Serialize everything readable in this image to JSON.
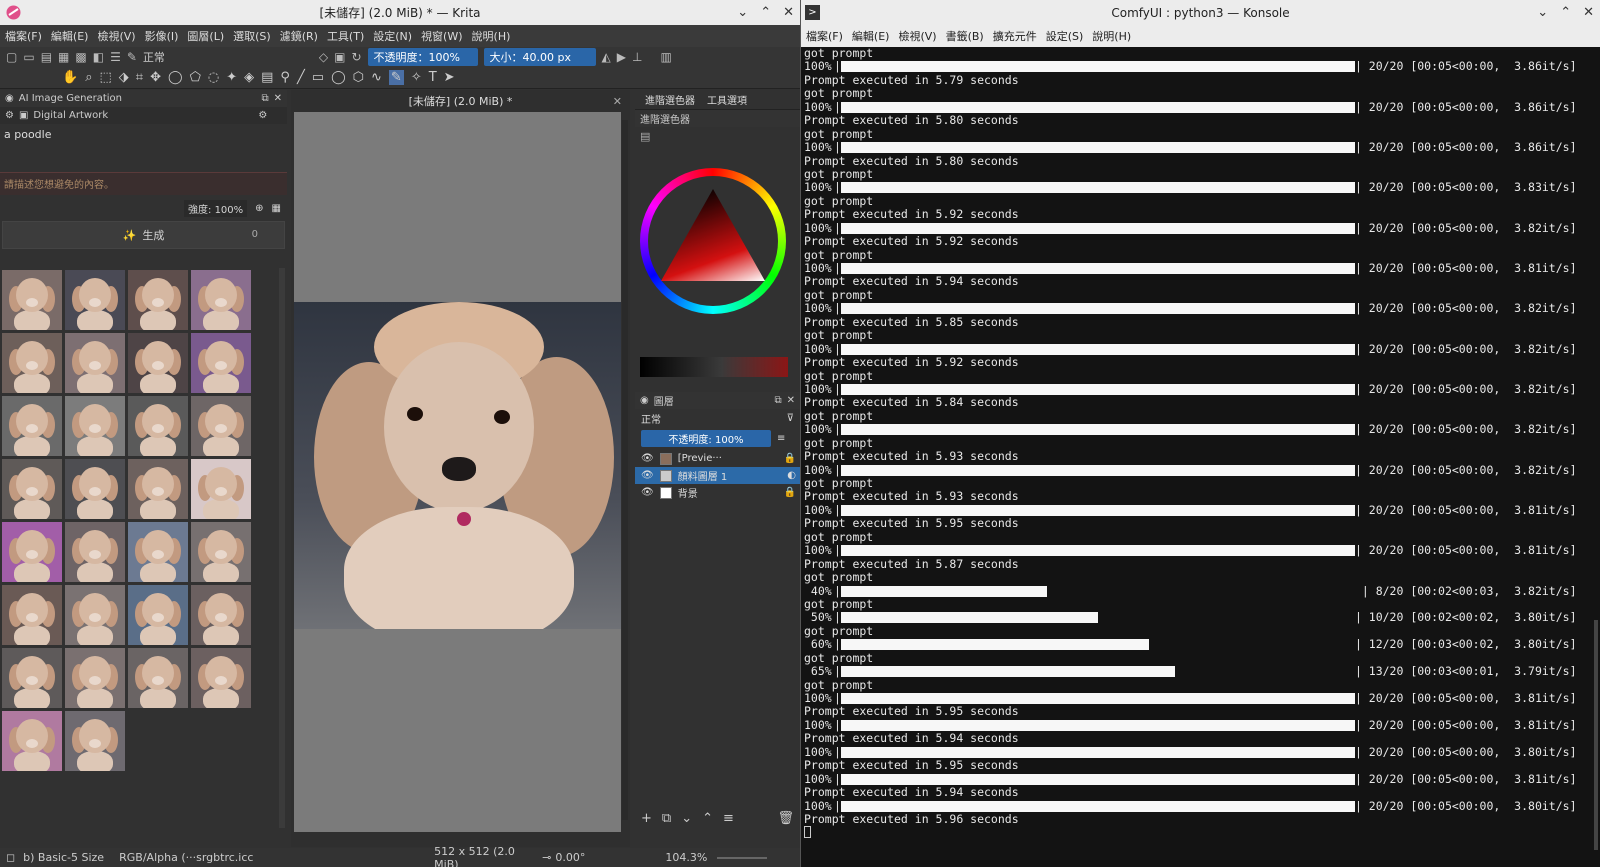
{
  "krita": {
    "title": "[未儲存] (2.0 MiB) * — Krita",
    "menu": [
      "檔案(F)",
      "編輯(E)",
      "檢視(V)",
      "影像(I)",
      "圖層(L)",
      "選取(S)",
      "濾鏡(R)",
      "工具(T)",
      "設定(N)",
      "視窗(W)",
      "說明(H)"
    ],
    "toolbar": {
      "blend_mode": "正常",
      "opacity_label": "不透明度：100%",
      "size_label": "大小",
      "size_value": "40.00 px"
    },
    "ai_panel": {
      "title": "AI Image Generation",
      "style": "Digital Artwork",
      "prompt": "a poodle",
      "negative_placeholder": "請描述您想避免的內容。",
      "strength": "強度: 100%",
      "generate": "生成",
      "queue_count": "0",
      "thumbnail_count": 30
    },
    "canvas": {
      "tab_title": "[未儲存] (2.0 MiB) *"
    },
    "right_panel": {
      "tab1": "進階選色器",
      "tab2": "工具選項",
      "color_header": "進階選色器",
      "layers_header": "圖層",
      "layer_blend": "正常",
      "layer_opacity": "不透明度: 100%",
      "layers": [
        {
          "name": "[Previe···",
          "selected": false
        },
        {
          "name": "顏料圖層 1",
          "selected": true
        },
        {
          "name": "背景",
          "selected": false
        }
      ]
    },
    "status": {
      "brush": "b) Basic-5 Size",
      "color_space": "RGB/Alpha (···srgbtrc.icc",
      "image_size": "512 x 512 (2.0 MiB)",
      "rotation": "0.00°",
      "zoom": "104.3%"
    }
  },
  "konsole": {
    "title": "ComfyUI : python3 — Konsole",
    "menu": [
      "檔案(F)",
      "編輯(E)",
      "檢視(V)",
      "書籤(B)",
      "擴充元件",
      "設定(S)",
      "說明(H)"
    ],
    "lines": [
      {
        "t": "text",
        "s": "got prompt"
      },
      {
        "t": "bar",
        "pct": "100%",
        "fill": 1.0,
        "stats": "| 20/20 [00:05<00:00,  3.86it/s]"
      },
      {
        "t": "text",
        "s": "Prompt executed in 5.79 seconds"
      },
      {
        "t": "text",
        "s": "got prompt"
      },
      {
        "t": "bar",
        "pct": "100%",
        "fill": 1.0,
        "stats": "| 20/20 [00:05<00:00,  3.86it/s]"
      },
      {
        "t": "text",
        "s": "Prompt executed in 5.80 seconds"
      },
      {
        "t": "text",
        "s": "got prompt"
      },
      {
        "t": "bar",
        "pct": "100%",
        "fill": 1.0,
        "stats": "| 20/20 [00:05<00:00,  3.86it/s]"
      },
      {
        "t": "text",
        "s": "Prompt executed in 5.80 seconds"
      },
      {
        "t": "text",
        "s": "got prompt"
      },
      {
        "t": "bar",
        "pct": "100%",
        "fill": 1.0,
        "stats": "| 20/20 [00:05<00:00,  3.83it/s]"
      },
      {
        "t": "text",
        "s": "got prompt"
      },
      {
        "t": "text",
        "s": "Prompt executed in 5.92 seconds"
      },
      {
        "t": "bar",
        "pct": "100%",
        "fill": 1.0,
        "stats": "| 20/20 [00:05<00:00,  3.82it/s]"
      },
      {
        "t": "text",
        "s": "Prompt executed in 5.92 seconds"
      },
      {
        "t": "text",
        "s": "got prompt"
      },
      {
        "t": "bar",
        "pct": "100%",
        "fill": 1.0,
        "stats": "| 20/20 [00:05<00:00,  3.81it/s]"
      },
      {
        "t": "text",
        "s": "Prompt executed in 5.94 seconds"
      },
      {
        "t": "text",
        "s": "got prompt"
      },
      {
        "t": "bar",
        "pct": "100%",
        "fill": 1.0,
        "stats": "| 20/20 [00:05<00:00,  3.82it/s]"
      },
      {
        "t": "text",
        "s": "Prompt executed in 5.85 seconds"
      },
      {
        "t": "text",
        "s": "got prompt"
      },
      {
        "t": "bar",
        "pct": "100%",
        "fill": 1.0,
        "stats": "| 20/20 [00:05<00:00,  3.82it/s]"
      },
      {
        "t": "text",
        "s": "Prompt executed in 5.92 seconds"
      },
      {
        "t": "text",
        "s": "got prompt"
      },
      {
        "t": "bar",
        "pct": "100%",
        "fill": 1.0,
        "stats": "| 20/20 [00:05<00:00,  3.82it/s]"
      },
      {
        "t": "text",
        "s": "Prompt executed in 5.84 seconds"
      },
      {
        "t": "text",
        "s": "got prompt"
      },
      {
        "t": "bar",
        "pct": "100%",
        "fill": 1.0,
        "stats": "| 20/20 [00:05<00:00,  3.82it/s]"
      },
      {
        "t": "text",
        "s": "got prompt"
      },
      {
        "t": "text",
        "s": "Prompt executed in 5.93 seconds"
      },
      {
        "t": "bar",
        "pct": "100%",
        "fill": 1.0,
        "stats": "| 20/20 [00:05<00:00,  3.82it/s]"
      },
      {
        "t": "text",
        "s": "got prompt"
      },
      {
        "t": "text",
        "s": "Prompt executed in 5.93 seconds"
      },
      {
        "t": "bar",
        "pct": "100%",
        "fill": 1.0,
        "stats": "| 20/20 [00:05<00:00,  3.81it/s]"
      },
      {
        "t": "text",
        "s": "Prompt executed in 5.95 seconds"
      },
      {
        "t": "text",
        "s": "got prompt"
      },
      {
        "t": "bar",
        "pct": "100%",
        "fill": 1.0,
        "stats": "| 20/20 [00:05<00:00,  3.81it/s]"
      },
      {
        "t": "text",
        "s": "Prompt executed in 5.87 seconds"
      },
      {
        "t": "text",
        "s": "got prompt"
      },
      {
        "t": "bar",
        "pct": " 40%",
        "fill": 0.4,
        "stats": " | 8/20 [00:02<00:03,  3.82it/s]"
      },
      {
        "t": "text",
        "s": "got prompt"
      },
      {
        "t": "bar",
        "pct": " 50%",
        "fill": 0.5,
        "stats": "| 10/20 [00:02<00:02,  3.80it/s]"
      },
      {
        "t": "text",
        "s": "got prompt"
      },
      {
        "t": "bar",
        "pct": " 60%",
        "fill": 0.6,
        "stats": "| 12/20 [00:03<00:02,  3.80it/s]"
      },
      {
        "t": "text",
        "s": "got prompt"
      },
      {
        "t": "bar",
        "pct": " 65%",
        "fill": 0.65,
        "stats": "| 13/20 [00:03<00:01,  3.79it/s]"
      },
      {
        "t": "text",
        "s": "got prompt"
      },
      {
        "t": "bar",
        "pct": "100%",
        "fill": 1.0,
        "stats": "| 20/20 [00:05<00:00,  3.81it/s]"
      },
      {
        "t": "text",
        "s": "Prompt executed in 5.95 seconds"
      },
      {
        "t": "bar",
        "pct": "100%",
        "fill": 1.0,
        "stats": "| 20/20 [00:05<00:00,  3.81it/s]"
      },
      {
        "t": "text",
        "s": "Prompt executed in 5.94 seconds"
      },
      {
        "t": "bar",
        "pct": "100%",
        "fill": 1.0,
        "stats": "| 20/20 [00:05<00:00,  3.80it/s]"
      },
      {
        "t": "text",
        "s": "Prompt executed in 5.95 seconds"
      },
      {
        "t": "bar",
        "pct": "100%",
        "fill": 1.0,
        "stats": "| 20/20 [00:05<00:00,  3.81it/s]"
      },
      {
        "t": "text",
        "s": "Prompt executed in 5.94 seconds"
      },
      {
        "t": "bar",
        "pct": "100%",
        "fill": 1.0,
        "stats": "| 20/20 [00:05<00:00,  3.80it/s]"
      },
      {
        "t": "text",
        "s": "Prompt executed in 5.96 seconds"
      }
    ]
  }
}
